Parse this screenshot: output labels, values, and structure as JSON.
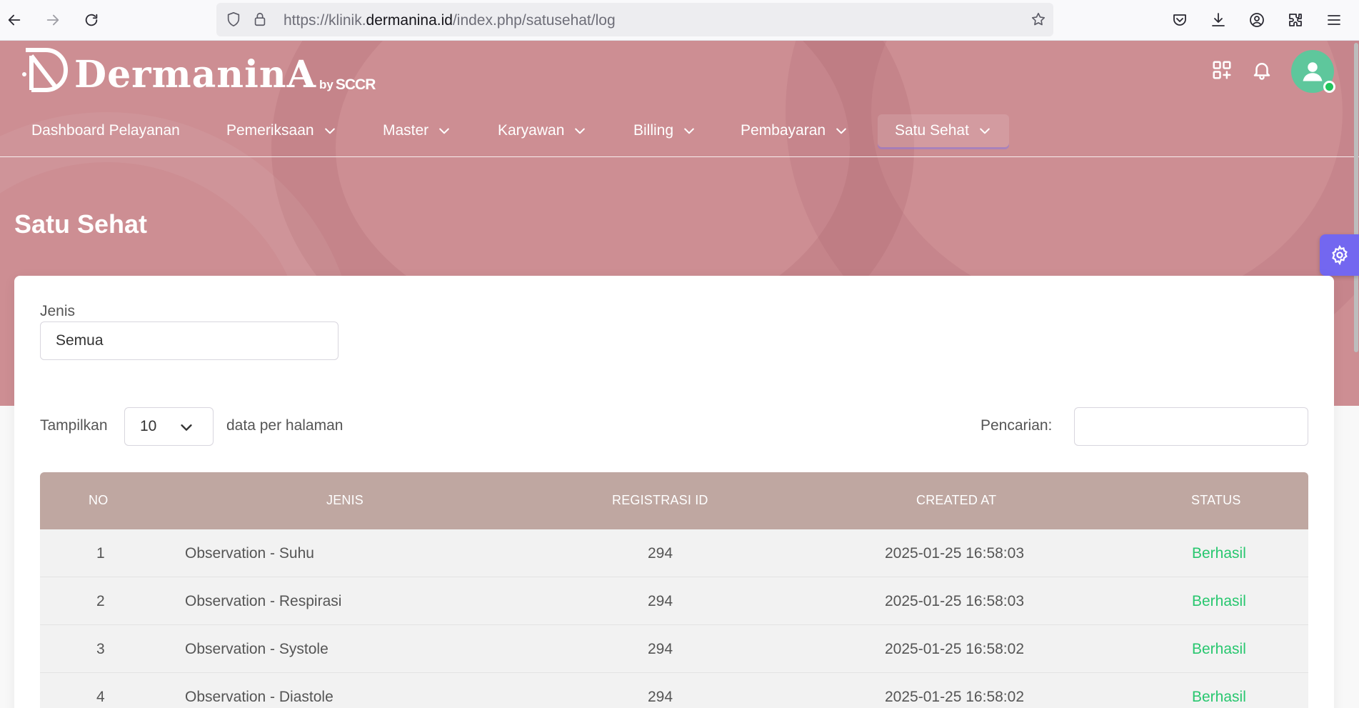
{
  "browser": {
    "url_prefix": "https://klinik.",
    "url_domain": "dermanina.id",
    "url_path": "/index.php/satusehat/log"
  },
  "brand": {
    "logo_text": "DermaninA",
    "by": "by",
    "partner": "SCCR"
  },
  "menu": [
    {
      "label": "Dashboard Pelayanan",
      "has_dropdown": false
    },
    {
      "label": "Pemeriksaan",
      "has_dropdown": true
    },
    {
      "label": "Master",
      "has_dropdown": true
    },
    {
      "label": "Karyawan",
      "has_dropdown": true
    },
    {
      "label": "Billing",
      "has_dropdown": true
    },
    {
      "label": "Pembayaran",
      "has_dropdown": true
    },
    {
      "label": "Satu Sehat",
      "has_dropdown": true,
      "active": true
    }
  ],
  "page": {
    "title": "Satu Sehat"
  },
  "filter": {
    "jenis_label": "Jenis",
    "jenis_value": "Semua"
  },
  "table_controls": {
    "show_label": "Tampilkan",
    "page_length": "10",
    "show_suffix": "data per halaman",
    "search_label": "Pencarian:",
    "search_value": ""
  },
  "table": {
    "headers": [
      "NO",
      "JENIS",
      "REGISTRASI ID",
      "CREATED AT",
      "STATUS"
    ],
    "rows": [
      {
        "no": "1",
        "jenis": "Observation - Suhu",
        "registrasi_id": "294",
        "created_at": "2025-01-25 16:58:03",
        "status": "Berhasil"
      },
      {
        "no": "2",
        "jenis": "Observation - Respirasi",
        "registrasi_id": "294",
        "created_at": "2025-01-25 16:58:03",
        "status": "Berhasil"
      },
      {
        "no": "3",
        "jenis": "Observation - Systole",
        "registrasi_id": "294",
        "created_at": "2025-01-25 16:58:02",
        "status": "Berhasil"
      },
      {
        "no": "4",
        "jenis": "Observation - Diastole",
        "registrasi_id": "294",
        "created_at": "2025-01-25 16:58:02",
        "status": "Berhasil"
      }
    ]
  },
  "colors": {
    "header_bg": "#cd8e93",
    "table_head_bg": "#bfa7a1",
    "status_success": "#28c76f",
    "settings_accent": "#7367f0",
    "avatar_bg": "#5ec79c"
  },
  "icons": {
    "back": "arrow-left-icon",
    "forward": "arrow-right-icon",
    "reload": "reload-icon",
    "apps": "apps-grid-icon",
    "notifications": "bell-icon",
    "settings": "gear-icon"
  }
}
